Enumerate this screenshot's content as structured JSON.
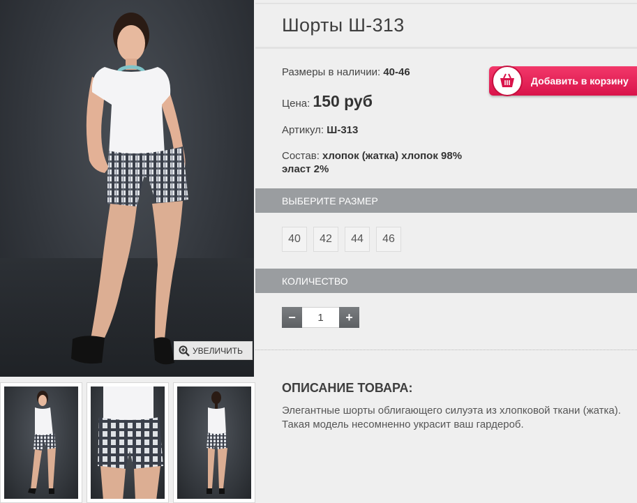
{
  "product": {
    "title": "Шорты Ш-313",
    "sizes_label": "Размеры в наличии:",
    "sizes_value": "40-46",
    "price_label": "Цена:",
    "price_value": "150 руб",
    "article_label": "Артикул:",
    "article_value": "Ш-313",
    "composition_label": "Состав:",
    "composition_value": "хлопок (жатка) хлопок 98% эласт 2%"
  },
  "cart": {
    "label": "Добавить в корзину"
  },
  "zoom": {
    "label": "УВЕЛИЧИТЬ"
  },
  "size_section": {
    "title": "ВЫБЕРИТЕ РАЗМЕР",
    "options": [
      "40",
      "42",
      "44",
      "46"
    ]
  },
  "quantity_section": {
    "title": "КОЛИЧЕСТВО",
    "minus": "−",
    "plus": "+",
    "value": "1"
  },
  "description": {
    "title": "ОПИСАНИЕ ТОВАРА:",
    "text": "Элегантные шорты облигающего силуэта из хлопковой ткани (жатка). Такая модель несомненно украсит ваш гардероб."
  },
  "colors": {
    "accent": "#e01f55",
    "section_header": "#9a9da0",
    "background": "#efefef"
  }
}
